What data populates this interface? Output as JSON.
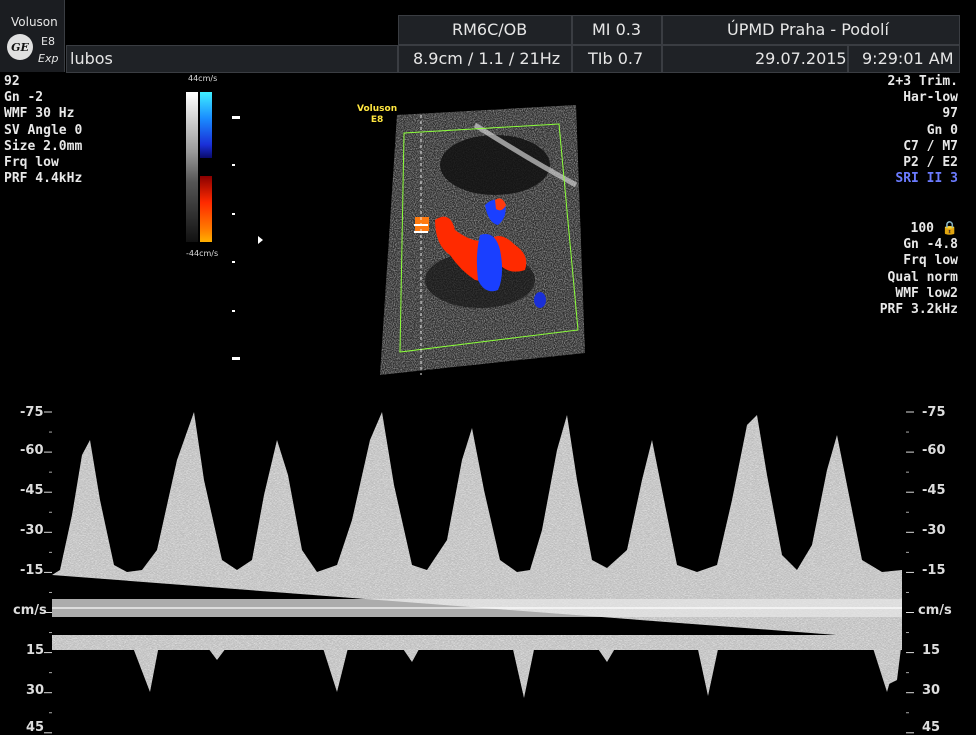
{
  "header": {
    "device_name": "Voluson",
    "model": "E8",
    "mode_suffix": "Exp",
    "patient": "lubos",
    "probe": "RM6C/OB",
    "mi": "MI  0.3",
    "institution": "ÚPMD Praha - Podolí",
    "depth_info": "8.9cm / 1.1 / 21Hz",
    "tib": "TIb  0.7",
    "date": "29.07.2015",
    "time": "9:29:01 AM"
  },
  "left_params": [
    "92",
    "Gn  -2",
    "WMF 30 Hz",
    "SV Angle  0",
    "Size  2.0mm",
    "Frq low",
    "PRF  4.4kHz"
  ],
  "right_params": [
    "2+3 Trim.",
    "Har-low",
    "97",
    "Gn   0",
    "C7 / M7",
    "P2 / E2",
    "SRI II 3"
  ],
  "right_params2": [
    "100",
    "Gn -4.8",
    "Frq low",
    "Qual norm",
    "WMF low2",
    "PRF  3.2kHz"
  ],
  "colorbar": {
    "top_label": "44cm/s",
    "bottom_label": "-44cm/s"
  },
  "image_label": {
    "line1": "Voluson",
    "line2": "E8"
  },
  "velocity_scale": {
    "labels": [
      "-75",
      "-60",
      "-45",
      "-30",
      "-15",
      "cm/s",
      "15",
      "30",
      "45"
    ],
    "unit": "cm/s"
  },
  "colors": {
    "header_bg": "#1f2226",
    "doppler_red": "#ff2a00",
    "doppler_blue": "#1a3fff",
    "roi_box": "#8cff3a",
    "sri_label": "#6b7bff",
    "image_label": "#ffe640"
  }
}
